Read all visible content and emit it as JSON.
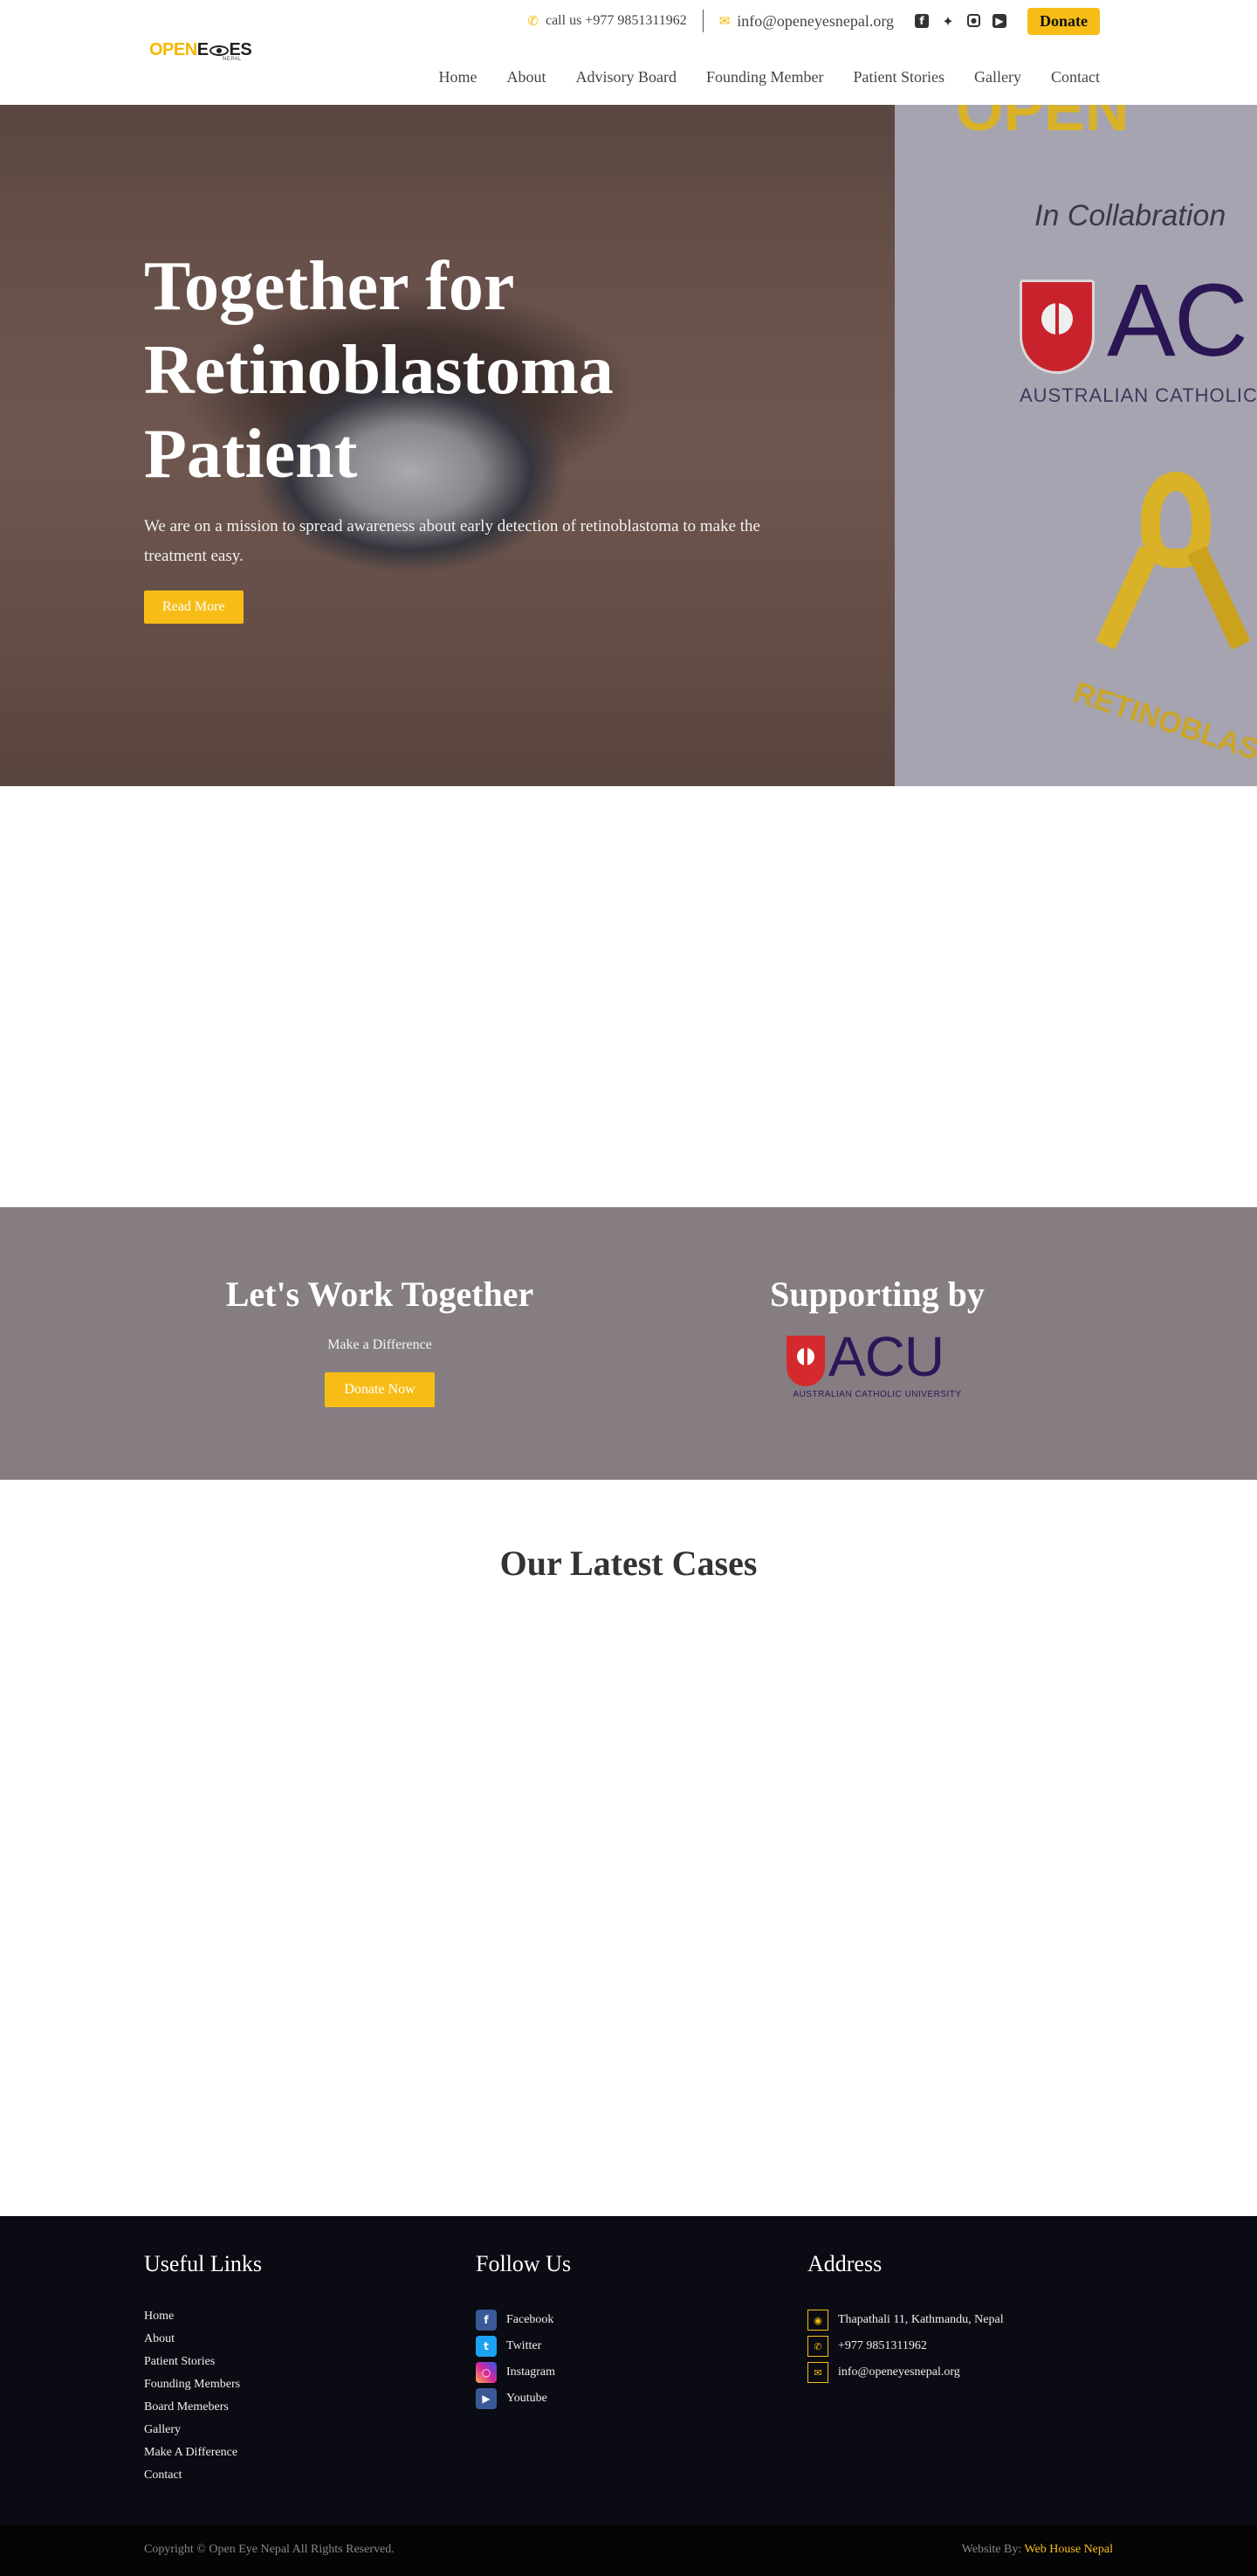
{
  "header": {
    "logo": {
      "open": "OPEN",
      "e": "E",
      "es": "ES",
      "sub": "NEPAL"
    },
    "call_label": "call us +977 9851311962",
    "email": "info@openeyesnepal.org",
    "donate": "Donate",
    "nav": [
      "Home",
      "About",
      "Advisory Board",
      "Founding Member",
      "Patient Stories",
      "Gallery",
      "Contact"
    ]
  },
  "hero": {
    "title_line1": "Together for",
    "title_line2": "Retinoblastoma",
    "title_line3": "Patient",
    "description": "We are on a mission to spread awareness about early detection of retinoblastoma to make the treatment easy.",
    "read_more": "Read More",
    "poster": {
      "collab": "In Collabration",
      "acu": "AC",
      "acu_sub": "AUSTRALIAN CATHOLIC U",
      "retino": "RETINOBLAST"
    }
  },
  "work": {
    "title": "Let's Work Together",
    "subtitle": "Make a Difference",
    "button": "Donate Now",
    "support_title": "Supporting by",
    "acu": "ACU",
    "acu_caption": "AUSTRALIAN CATHOLIC UNIVERSITY"
  },
  "cases": {
    "title": "Our Latest Cases"
  },
  "footer": {
    "useful_links_title": "Useful Links",
    "links": [
      "Home",
      "About",
      "Patient Stories",
      "Founding Members",
      "Board Memebers",
      "Gallery",
      "Make A Difference",
      "Contact"
    ],
    "follow_title": "Follow Us",
    "social": [
      {
        "label": "Facebook",
        "icon": "facebook-icon",
        "color": "#3b5998"
      },
      {
        "label": "Twitter",
        "icon": "twitter-icon",
        "color": "#1da1f2"
      },
      {
        "label": "Instagram",
        "icon": "instagram-icon",
        "color": "#d6249f"
      },
      {
        "label": "Youtube",
        "icon": "youtube-icon",
        "color": "#3b5998"
      }
    ],
    "address_title": "Address",
    "address": "Thapathali 11, Kathmandu, Nepal",
    "phone": "+977 9851311962",
    "email": "info@openeyesnepal.org",
    "copyright": "Copyright © Open Eye Nepal All Rights Reserved.",
    "website_by": "Website By:",
    "website_by_link": "Web House Nepal"
  },
  "colors": {
    "accent": "#f7bd16",
    "band": "#857d82",
    "footer": "#0b0c13"
  }
}
